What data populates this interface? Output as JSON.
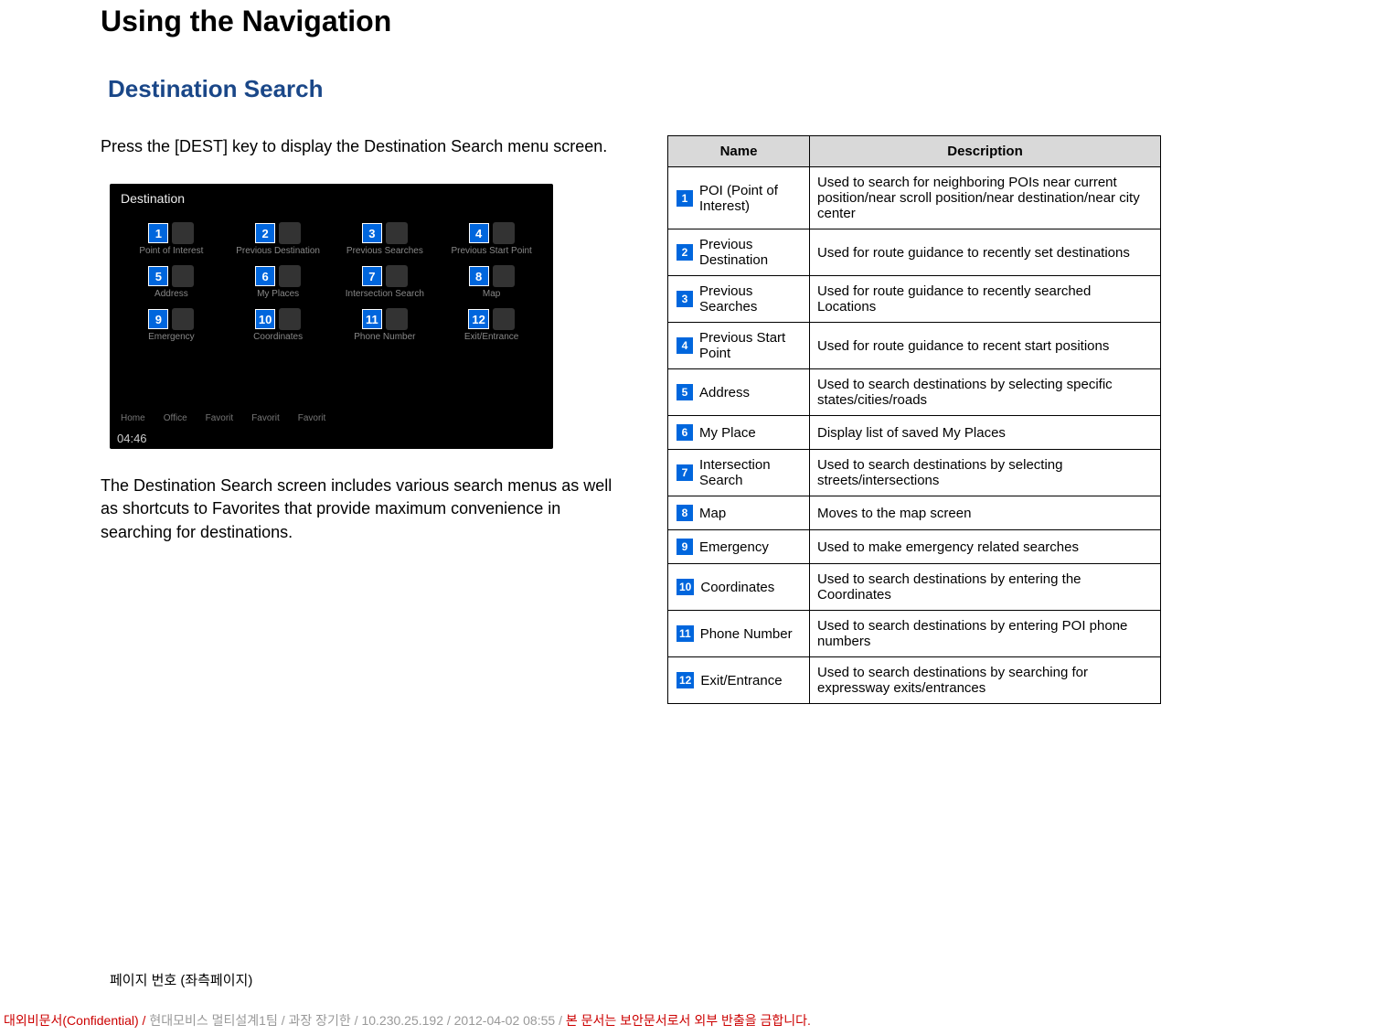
{
  "page_title": "Using the Navigation",
  "section_title": "Destination Search",
  "intro_text": "Press the [DEST] key to display the Destination Search menu screen.",
  "screenshot": {
    "title": "Destination",
    "time": "04:46",
    "cells": [
      {
        "num": "1",
        "label": "Point of Interest"
      },
      {
        "num": "2",
        "label": "Previous Destination"
      },
      {
        "num": "3",
        "label": "Previous Searches"
      },
      {
        "num": "4",
        "label": "Previous Start Point"
      },
      {
        "num": "5",
        "label": "Address"
      },
      {
        "num": "6",
        "label": "My Places"
      },
      {
        "num": "7",
        "label": "Intersection Search"
      },
      {
        "num": "8",
        "label": "Map"
      },
      {
        "num": "9",
        "label": "Emergency"
      },
      {
        "num": "10",
        "label": "Coordinates"
      },
      {
        "num": "11",
        "label": "Phone Number"
      },
      {
        "num": "12",
        "label": "Exit/Entrance"
      }
    ],
    "bottombar": [
      "Home",
      "Office",
      "Favorit",
      "Favorit",
      "Favorit"
    ]
  },
  "desc_text": "The Destination Search screen includes various search menus as well as shortcuts to Favorites that provide maximum convenience in searching for destinations.",
  "table_headers": {
    "name": "Name",
    "desc": "Description"
  },
  "table_rows": [
    {
      "num": "1",
      "name": "POI (Point of Interest)",
      "desc": "Used to search for neighboring POIs near current position/near scroll position/near destination/near city center"
    },
    {
      "num": "2",
      "name": "Previous Destination",
      "desc": "Used for route guidance to recently set destinations"
    },
    {
      "num": "3",
      "name": "Previous Searches",
      "desc": "Used for route guidance to recently searched Locations"
    },
    {
      "num": "4",
      "name": "Previous Start Point",
      "desc": "Used for route guidance to recent start positions"
    },
    {
      "num": "5",
      "name": "Address",
      "desc": "Used to search destinations by selecting specific states/cities/roads"
    },
    {
      "num": "6",
      "name": "My Place",
      "desc": "Display list of saved My Places"
    },
    {
      "num": "7",
      "name": "Intersection Search",
      "desc": "Used to search destinations by selecting streets/intersections"
    },
    {
      "num": "8",
      "name": "Map",
      "desc": "Moves to the map screen"
    },
    {
      "num": "9",
      "name": "Emergency",
      "desc": "Used to make emergency related searches"
    },
    {
      "num": "10",
      "name": "Coordinates",
      "desc": "Used to search destinations by entering the Coordinates"
    },
    {
      "num": "11",
      "name": "Phone Number",
      "desc": "Used to search destinations by entering POI phone numbers"
    },
    {
      "num": "12",
      "name": "Exit/Entrance",
      "desc": "Used to search destinations by searching for expressway exits/entrances"
    }
  ],
  "page_footer": "페이지 번호 (좌측페이지)",
  "confidential": {
    "prefix": "대외비문서(Confidential) / ",
    "middle": "현대모비스 멀티설계1팀 / 과장 장기한 / 10.230.25.192 / 2012-04-02 08:55 /",
    "suffix": " 본 문서는 보안문서로서 외부 반출을 금합니다."
  }
}
